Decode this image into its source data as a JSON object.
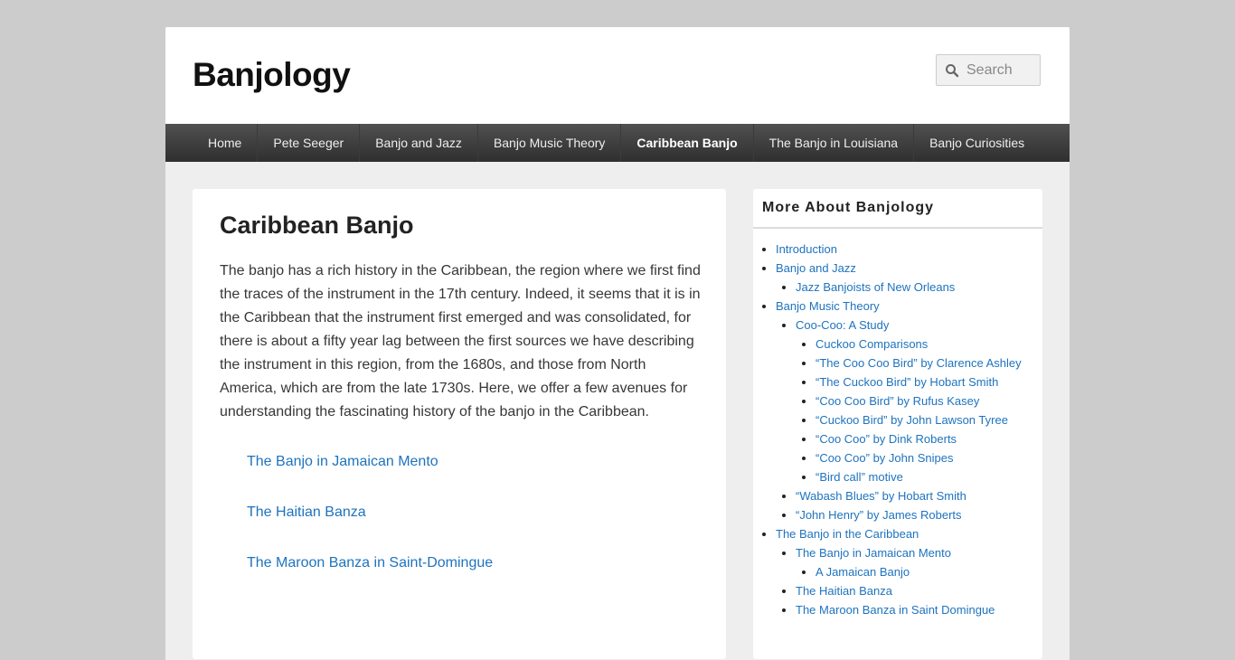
{
  "site": {
    "title": "Banjology"
  },
  "search": {
    "placeholder": "Search"
  },
  "nav": {
    "items": [
      "Home",
      "Pete Seeger",
      "Banjo and Jazz",
      "Banjo Music Theory",
      "Caribbean Banjo",
      "The Banjo in Louisiana",
      "Banjo Curiosities"
    ],
    "active": "Caribbean Banjo"
  },
  "main": {
    "heading": "Caribbean Banjo",
    "intro": "The banjo has a rich history in the Caribbean, the region where we first find the traces of the instrument in the 17th century. Indeed, it seems that it is in the Caribbean that the instrument first emerged and was consolidated, for there is about a fifty year lag between the first sources we have describing the instrument in this region, from the 1680s, and those from North America, which are from the late 1730s. Here, we offer a few avenues for understanding the fascinating history of the banjo in the Caribbean.",
    "links": [
      "The Banjo in Jamaican Mento",
      "The Haitian Banza",
      "The Maroon Banza in Saint-Domingue"
    ]
  },
  "sidebar": {
    "title": "More About Banjology",
    "items": [
      {
        "label": "Introduction"
      },
      {
        "label": "Banjo and Jazz",
        "children": [
          {
            "label": "Jazz Banjoists of New Orleans"
          }
        ]
      },
      {
        "label": "Banjo Music Theory",
        "children": [
          {
            "label": "Coo-Coo: A Study",
            "children": [
              {
                "label": "Cuckoo Comparisons"
              },
              {
                "label": "“The Coo Coo Bird” by Clarence Ashley"
              },
              {
                "label": "“The Cuckoo Bird” by Hobart Smith"
              },
              {
                "label": "“Coo Coo Bird” by Rufus Kasey"
              },
              {
                "label": "“Cuckoo Bird” by John Lawson Tyree"
              },
              {
                "label": "“Coo Coo” by Dink Roberts"
              },
              {
                "label": "“Coo Coo” by John Snipes"
              },
              {
                "label": "“Bird call” motive"
              }
            ]
          },
          {
            "label": "“Wabash Blues” by Hobart Smith"
          },
          {
            "label": "“John Henry” by James Roberts"
          }
        ]
      },
      {
        "label": "The Banjo in the Caribbean",
        "children": [
          {
            "label": "The Banjo in Jamaican Mento",
            "children": [
              {
                "label": "A Jamaican Banjo"
              }
            ]
          },
          {
            "label": "The Haitian Banza"
          },
          {
            "label": "The Maroon Banza in Saint Domingue"
          }
        ]
      }
    ]
  }
}
